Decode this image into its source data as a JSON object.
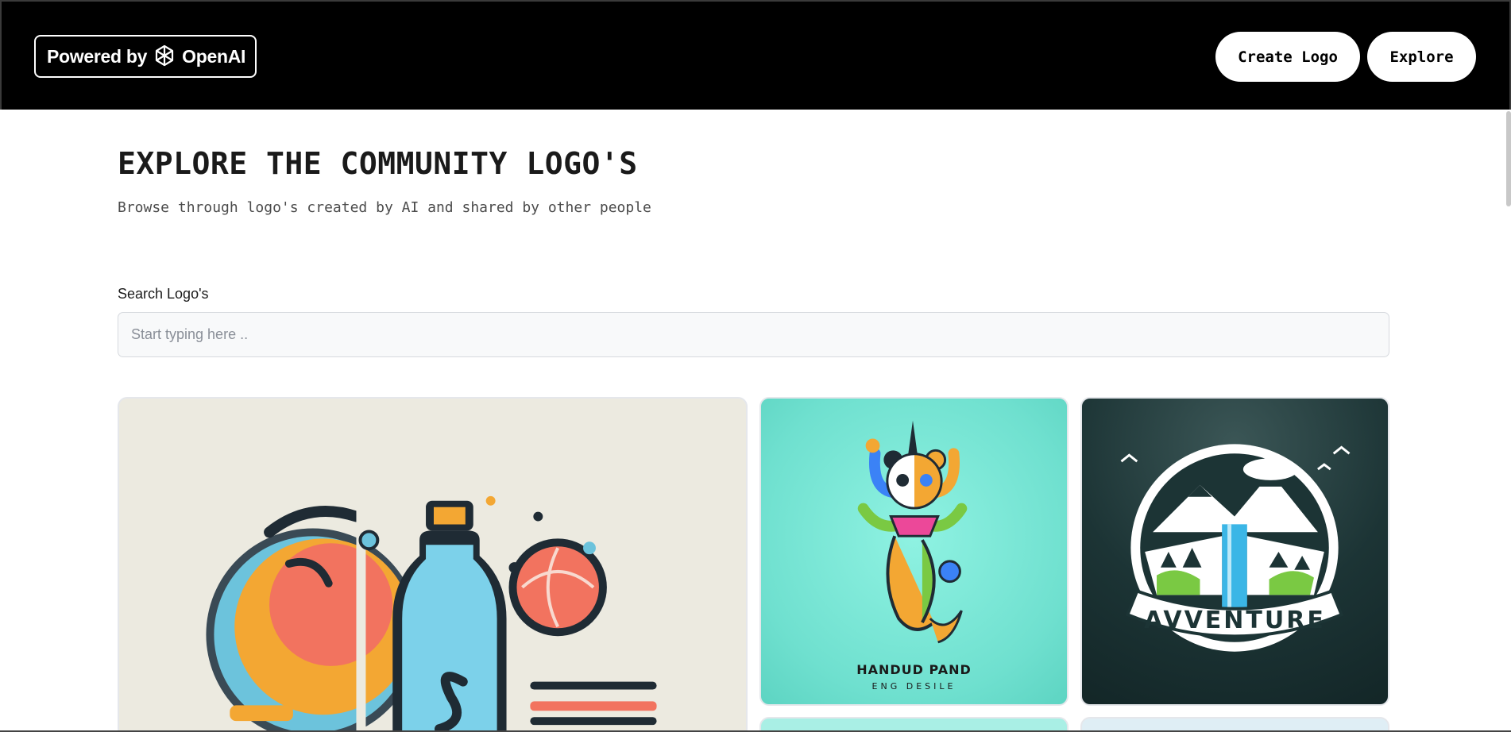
{
  "header": {
    "powered_prefix": "Powered by",
    "powered_brand": "OpenAI",
    "create_logo_label": "Create Logo",
    "explore_label": "Explore"
  },
  "main": {
    "title": "EXPLORE THE COMMUNITY LOGO'S",
    "subtitle": "Browse through logo's created by AI and shared by other people",
    "search": {
      "label": "Search Logo's",
      "placeholder": "Start typing here ..",
      "value": ""
    },
    "gallery": [
      {
        "name": "bottle-logo",
        "text": ""
      },
      {
        "name": "panda-mermaid-logo",
        "text": "HANDUD PAND",
        "subtext": "ENG DESILE"
      },
      {
        "name": "adventure-logo",
        "text": "AVVENTURE"
      }
    ]
  },
  "colors": {
    "header_bg": "#000000",
    "button_bg": "#ffffff",
    "panda_card_bg": "#6fe0cf",
    "adventure_card_bg": "#1c3435"
  }
}
